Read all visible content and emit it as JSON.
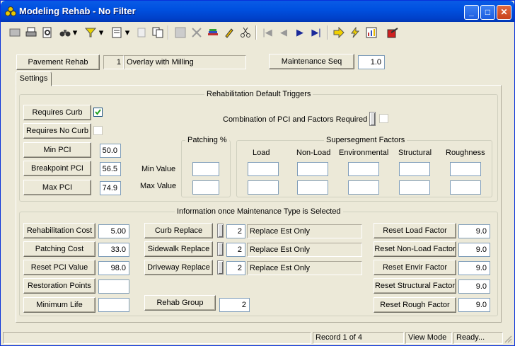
{
  "window": {
    "title": "Modeling Rehab - No Filter",
    "minimize": "_",
    "maximize": "□",
    "close": "✕"
  },
  "toolbar": {
    "dropdown_arrow": "▾",
    "nav_first": "|◀",
    "nav_prev": "◀",
    "nav_next": "▶",
    "nav_last": "▶|"
  },
  "header": {
    "pavement_rehab_button": "Pavement Rehab",
    "pavement_rehab_id": "1",
    "pavement_rehab_name": "Overlay with Milling",
    "maintenance_seq_button": "Maintenance Seq",
    "maintenance_seq_value": "1.0"
  },
  "tabs": [
    {
      "label": "Settings"
    }
  ],
  "triggers": {
    "title": "Rehabilitation Default Triggers",
    "requires_curb_label": "Requires Curb",
    "requires_curb_checked": true,
    "requires_no_curb_label": "Requires No Curb",
    "requires_no_curb_checked": false,
    "combination_label": "Combination of PCI and Factors  Required",
    "min_pci_label": "Min PCI",
    "min_pci_value": "50.0",
    "breakpoint_pci_label": "Breakpoint PCI",
    "breakpoint_pci_value": "56.5",
    "max_pci_label": "Max PCI",
    "max_pci_value": "74.9",
    "min_value_label": "Min Value",
    "max_value_label": "Max Value",
    "patching_title": "Patching %",
    "supersegment_title": "Supersegment Factors",
    "factor_columns": [
      "Load",
      "Non-Load",
      "Environmental",
      "Structural",
      "Roughness"
    ]
  },
  "info": {
    "title": "Information once Maintenance Type is Selected",
    "left": [
      {
        "label": "Rehabilitation Cost",
        "value": "5.00"
      },
      {
        "label": "Patching Cost",
        "value": "33.0"
      },
      {
        "label": "Reset PCI Value",
        "value": "98.0"
      },
      {
        "label": "Restoration Points",
        "value": ""
      },
      {
        "label": "Minimum Life",
        "value": ""
      }
    ],
    "middle": [
      {
        "label": "Curb Replace",
        "num": "2",
        "text": "Replace Est Only"
      },
      {
        "label": "Sidewalk Replace",
        "num": "2",
        "text": "Replace Est Only"
      },
      {
        "label": "Driveway Replace",
        "num": "2",
        "text": "Replace Est Only"
      }
    ],
    "rehab_group_label": "Rehab Group",
    "rehab_group_value": "2",
    "right": [
      {
        "label": "Reset Load Factor",
        "value": "9.0"
      },
      {
        "label": "Reset Non-Load Factor",
        "value": "9.0"
      },
      {
        "label": "Reset Envir Factor",
        "value": "9.0"
      },
      {
        "label": "Reset Structural Factor",
        "value": "9.0"
      },
      {
        "label": "Reset Rough Factor",
        "value": "9.0"
      }
    ]
  },
  "status": {
    "record": "Record 1 of 4",
    "mode": "View Mode",
    "state": "Ready..."
  }
}
